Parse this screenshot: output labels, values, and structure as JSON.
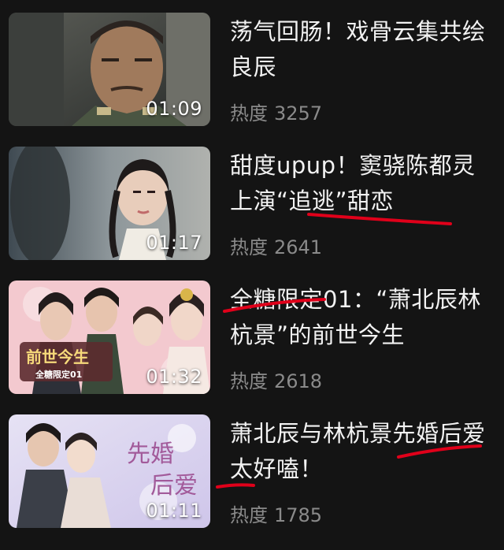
{
  "videos": [
    {
      "title": "荡气回肠！戏骨云集共绘良辰",
      "heat_label": "热度",
      "heat_value": "3257",
      "duration": "01:09"
    },
    {
      "title": "甜度upup！窦骁陈都灵上演“追逃”甜恋",
      "heat_label": "热度",
      "heat_value": "2641",
      "duration": "01:17"
    },
    {
      "title": "全糖限定01：“萧北辰林杭景”的前世今生",
      "heat_label": "热度",
      "heat_value": "2618",
      "duration": "01:32",
      "thumb_text": [
        "前世今生",
        "全糖限定01"
      ]
    },
    {
      "title": "萧北辰与林杭景先婚后爱太好嗑！",
      "heat_label": "热度",
      "heat_value": "1785",
      "duration": "01:11",
      "thumb_text": [
        "先婚",
        "后爱"
      ]
    }
  ],
  "colors": {
    "background": "#141414",
    "title": "#f2f2f2",
    "meta": "#8a8a8a",
    "annotation": "#e0001a"
  }
}
